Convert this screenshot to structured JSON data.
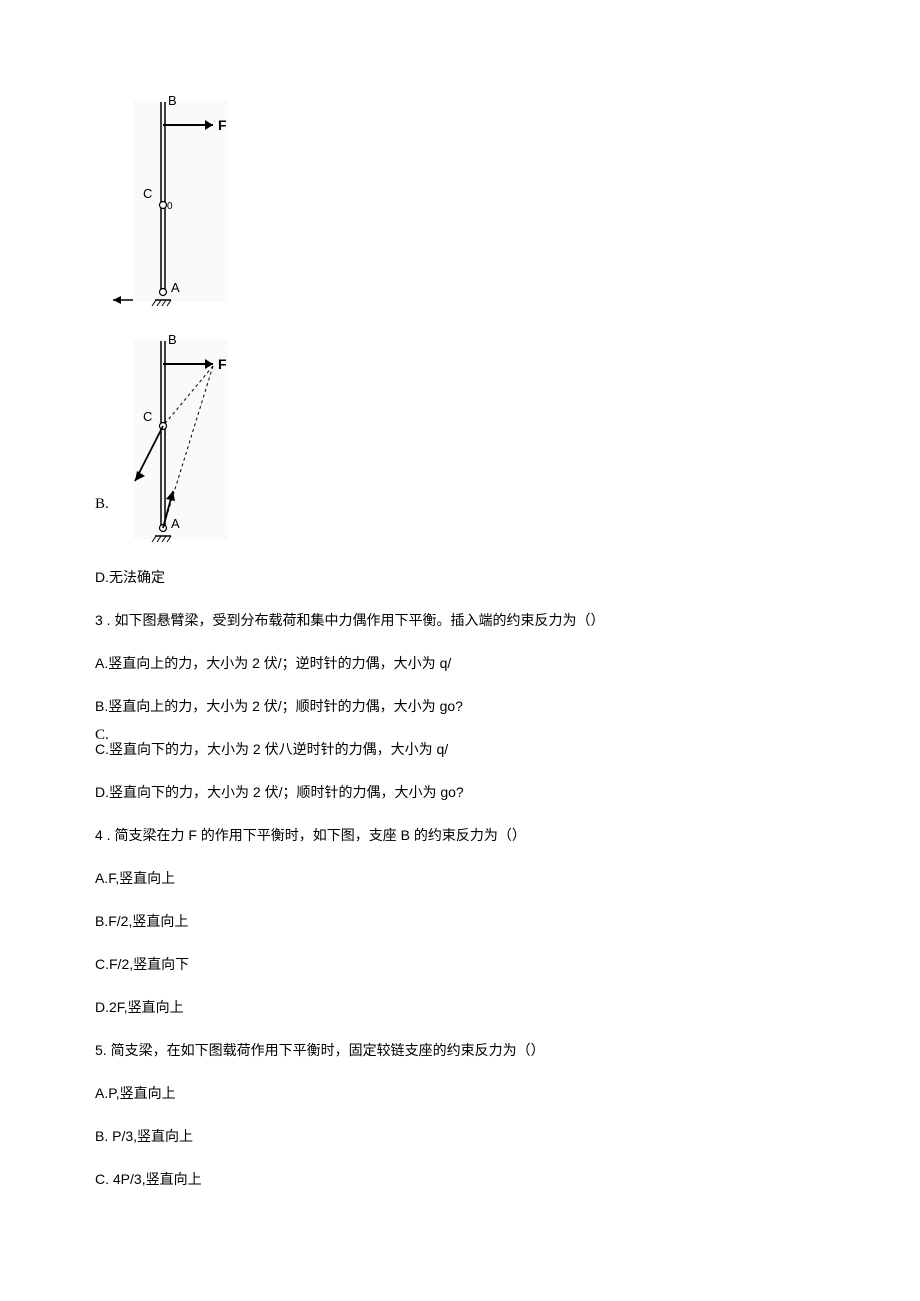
{
  "figureB": {
    "label": "B.",
    "pointB": "B",
    "pointC": "C",
    "pointA": "A",
    "forceF": "F"
  },
  "figureC": {
    "label": "C.",
    "pointB": "B",
    "pointC": "C",
    "pointA": "A",
    "forceF": "F"
  },
  "optionD_q2": "D.无法确定",
  "q3": {
    "stem": "3 . 如下图悬臂梁，受到分布载荷和集中力偶作用下平衡。插入端的约束反力为（）",
    "A": "A.竖直向上的力，大小为 2 伏/；逆时针的力偶，大小为 q/",
    "B": "B.竖直向上的力，大小为 2 伏/；顺时针的力偶，大小为 go?",
    "C": "C.竖直向下的力，大小为 2 伏八逆时针的力偶，大小为 q/",
    "D": "D.竖直向下的力，大小为 2 伏/；顺时针的力偶，大小为 go?"
  },
  "q4": {
    "stem": "4 . 简支梁在力 F 的作用下平衡时，如下图，支座 B 的约束反力为（）",
    "A": "A.F,竖直向上",
    "B": "B.F/2,竖直向上",
    "C": "C.F/2,竖直向下",
    "D": "D.2F,竖直向上"
  },
  "q5": {
    "stem": "5. 简支梁，在如下图载荷作用下平衡时，固定较链支座的约束反力为（）",
    "A": "A.P,竖直向上",
    "B": "B.   P/3,竖直向上",
    "C": "C.   4P/3,竖直向上"
  }
}
